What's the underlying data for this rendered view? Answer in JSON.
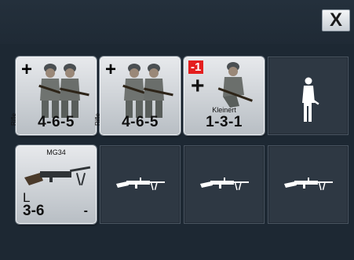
{
  "close_button": {
    "label": "X"
  },
  "row1": [
    {
      "type": "squad",
      "modifier": "+",
      "side_label": "Rifle",
      "stats": "4-6-5",
      "icon": "soldier-pair-art"
    },
    {
      "type": "squad",
      "modifier": "+",
      "side_label": "Rifle",
      "stats": "4-6-5",
      "icon": "soldier-pair-art"
    },
    {
      "type": "leader",
      "badge": "-1",
      "modifier": "+",
      "name": "Kleinert",
      "stats": "1-3-1",
      "icon": "kneeling-leader-art"
    },
    {
      "type": "empty-slot",
      "icon": "soldier-silhouette-icon"
    }
  ],
  "row2": [
    {
      "type": "weapon",
      "title": "MG34",
      "range": "L",
      "stats": "3-6",
      "extra": "-",
      "icon": "machine-gun-art"
    },
    {
      "type": "empty-slot",
      "icon": "machine-gun-silhouette-icon"
    },
    {
      "type": "empty-slot",
      "icon": "machine-gun-silhouette-icon"
    },
    {
      "type": "empty-slot",
      "icon": "machine-gun-silhouette-icon"
    }
  ],
  "colors": {
    "background": "#1d2833",
    "slot": "#2e3843",
    "counter": "#d3d7db",
    "badge": "#e41e1e"
  }
}
